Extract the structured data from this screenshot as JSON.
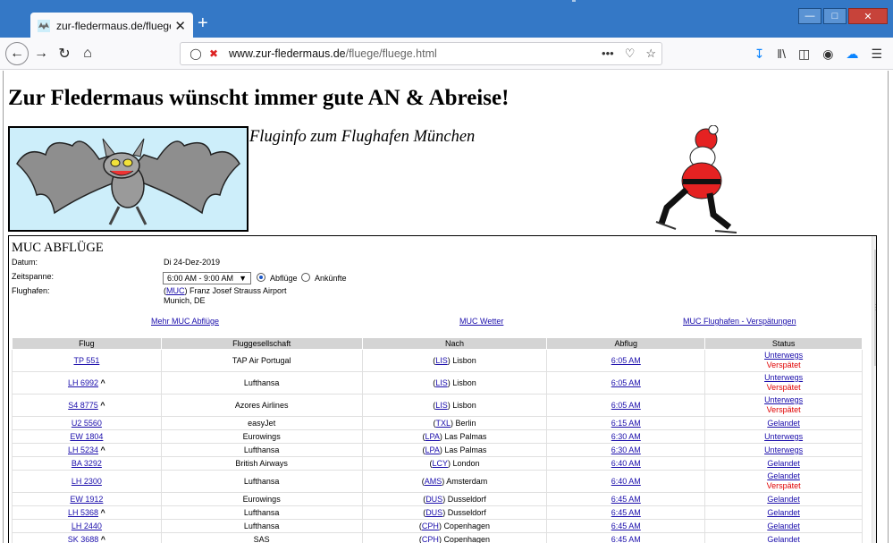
{
  "browser": {
    "tab_title": "zur-fledermaus.de/fluege/flug",
    "url_domain": "www.zur-fledermaus.de",
    "url_path": "/fluege/fluege.html",
    "url_prefix": "www."
  },
  "page": {
    "headline": "Zur Fledermaus wünscht immer gute AN & Abreise!",
    "subtitle": "Fluginfo zum Flughafen München"
  },
  "flights": {
    "title": "MUC ABFLÜGE",
    "labels": {
      "date": "Datum:",
      "timespan": "Zeitspanne:",
      "airport": "Flughafen:"
    },
    "date_value": "Di 24-Dez-2019",
    "timespan_value": "6:00 AM - 9:00 AM",
    "radio_departures": "Abflüge",
    "radio_arrivals": "Ankünfte",
    "airport_code": "MUC",
    "airport_name": "Franz Josef Strauss Airport",
    "airport_city": "Munich, DE",
    "links": {
      "more": "Mehr MUC Abflüge",
      "weather": "MUC Wetter",
      "delays": "MUC Flughafen - Verspätungen"
    },
    "columns": [
      "Flug",
      "Fluggesellschaft",
      "Nach",
      "Abflug",
      "Status"
    ],
    "rows": [
      {
        "flight": "TP 551",
        "carat": "",
        "airline": "TAP Air Portugal",
        "code": "LIS",
        "city": "Lisbon",
        "time": "6:05 AM",
        "status": "Unterwegs",
        "delay": "Verspätet"
      },
      {
        "flight": "LH 6992",
        "carat": "^",
        "airline": "Lufthansa",
        "code": "LIS",
        "city": "Lisbon",
        "time": "6:05 AM",
        "status": "Unterwegs",
        "delay": "Verspätet"
      },
      {
        "flight": "S4 8775",
        "carat": "^",
        "airline": "Azores Airlines",
        "code": "LIS",
        "city": "Lisbon",
        "time": "6:05 AM",
        "status": "Unterwegs",
        "delay": "Verspätet"
      },
      {
        "flight": "U2 5560",
        "carat": "",
        "airline": "easyJet",
        "code": "TXL",
        "city": "Berlin",
        "time": "6:15 AM",
        "status": "Gelandet",
        "delay": ""
      },
      {
        "flight": "EW 1804",
        "carat": "",
        "airline": "Eurowings",
        "code": "LPA",
        "city": "Las Palmas",
        "time": "6:30 AM",
        "status": "Unterwegs",
        "delay": ""
      },
      {
        "flight": "LH 5234",
        "carat": "^",
        "airline": "Lufthansa",
        "code": "LPA",
        "city": "Las Palmas",
        "time": "6:30 AM",
        "status": "Unterwegs",
        "delay": ""
      },
      {
        "flight": "BA 3292",
        "carat": "",
        "airline": "British Airways",
        "code": "LCY",
        "city": "London",
        "time": "6:40 AM",
        "status": "Gelandet",
        "delay": ""
      },
      {
        "flight": "LH 2300",
        "carat": "",
        "airline": "Lufthansa",
        "code": "AMS",
        "city": "Amsterdam",
        "time": "6:40 AM",
        "status": "Gelandet",
        "delay": "Verspätet"
      },
      {
        "flight": "EW 1912",
        "carat": "",
        "airline": "Eurowings",
        "code": "DUS",
        "city": "Dusseldorf",
        "time": "6:45 AM",
        "status": "Gelandet",
        "delay": ""
      },
      {
        "flight": "LH 5368",
        "carat": "^",
        "airline": "Lufthansa",
        "code": "DUS",
        "city": "Dusseldorf",
        "time": "6:45 AM",
        "status": "Gelandet",
        "delay": ""
      },
      {
        "flight": "LH 2440",
        "carat": "",
        "airline": "Lufthansa",
        "code": "CPH",
        "city": "Copenhagen",
        "time": "6:45 AM",
        "status": "Gelandet",
        "delay": ""
      },
      {
        "flight": "SK 3688",
        "carat": "^",
        "airline": "SAS",
        "code": "CPH",
        "city": "Copenhagen",
        "time": "6:45 AM",
        "status": "Gelandet",
        "delay": ""
      }
    ]
  },
  "colors": {
    "titlebar": "#3478c6",
    "link": "#1a0dab",
    "delay_red": "#e00000",
    "header_gray": "#d4d4d4",
    "bat_bg": "#cdeefa"
  },
  "icons": [
    "bat-favicon-icon",
    "close-icon",
    "plus-icon",
    "back-arrow-icon",
    "forward-arrow-icon",
    "reload-icon",
    "home-icon",
    "shield-icon",
    "insecure-icon",
    "more-icon",
    "pocket-icon",
    "star-icon",
    "download-icon",
    "library-icon",
    "sidebar-icon",
    "account-icon",
    "cloud-icon",
    "menu-icon"
  ]
}
